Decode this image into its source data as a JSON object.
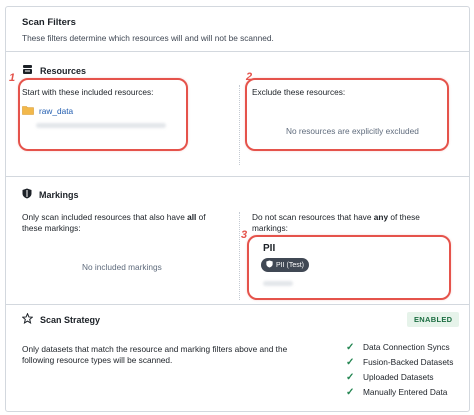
{
  "header": {
    "title": "Scan Filters",
    "description": "These filters determine which resources will and will not be scanned."
  },
  "resources": {
    "title": "Resources",
    "include_label": "Start with these included resources:",
    "included_items": [
      {
        "name": "raw_data",
        "icon": "folder-icon"
      }
    ],
    "exclude_label": "Exclude these resources:",
    "exclude_empty": "No resources are explicitly excluded"
  },
  "markings": {
    "title": "Markings",
    "include_label_pre": "Only scan included resources that also have ",
    "include_label_bold": "all",
    "include_label_post": " of these markings:",
    "include_empty": "No included markings",
    "exclude_label_pre": "Do not scan resources that have ",
    "exclude_label_bold": "any",
    "exclude_label_post": " of these markings:",
    "excluded_marking": {
      "name": "PII",
      "pill": "PII (Test)"
    }
  },
  "strategy": {
    "title": "Scan Strategy",
    "status": "ENABLED",
    "description": "Only datasets that match the resource and marking filters above and the following resource types will be scanned.",
    "types": [
      "Data Connection Syncs",
      "Fusion-Backed Datasets",
      "Uploaded Datasets",
      "Manually Entered Data"
    ]
  },
  "callouts": [
    "1",
    "2",
    "3"
  ],
  "colors": {
    "accent_red": "#e5534b",
    "link_blue": "#215db0",
    "success_green": "#238551",
    "enabled_bg": "#e6f3ea"
  }
}
